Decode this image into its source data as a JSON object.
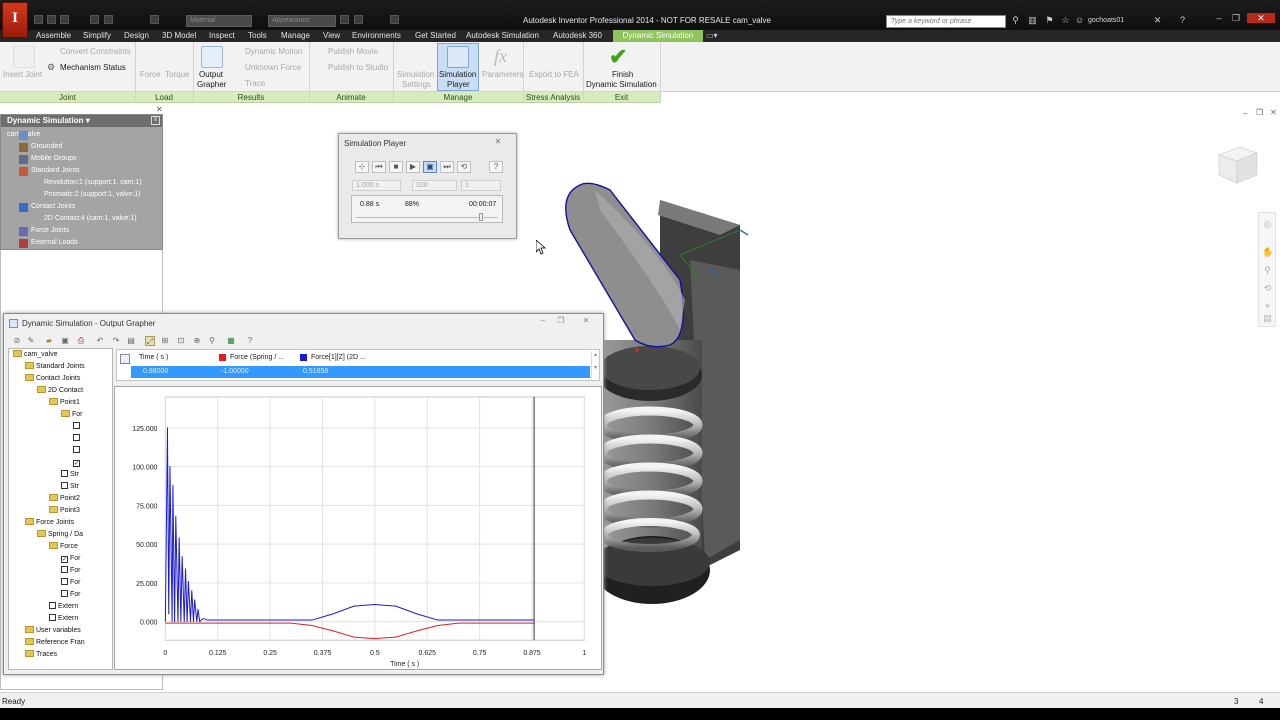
{
  "app": {
    "logo": "I",
    "title": "Autodesk Inventor Professional 2014 - NOT FOR RESALE   cam_valve",
    "material_placeholder": "Material",
    "appearance_placeholder": "Appearance",
    "search_placeholder": "Type a keyword or phrase",
    "user": "gochoats01"
  },
  "ribbon_tabs": [
    "Assemble",
    "Simplify",
    "Design",
    "3D Model",
    "Inspect",
    "Tools",
    "Manage",
    "View",
    "Environments",
    "Get Started",
    "Autodesk Simulation",
    "Autodesk 360",
    "Dynamic Simulation"
  ],
  "ribbon": {
    "joint": {
      "insert_joint": "Insert Joint",
      "convert_constraints": "Convert Constraints",
      "mechanism_status": "Mechanism Status"
    },
    "load": {
      "force": "Force",
      "torque": "Torque"
    },
    "results": {
      "output_grapher_1": "Output",
      "output_grapher_2": "Grapher",
      "dynamic_motion": "Dynamic Motion",
      "unknown_force": "Unknown Force",
      "trace": "Trace"
    },
    "animate": {
      "publish_movie": "Publish Movie",
      "publish_studio": "Publish to Studio"
    },
    "manage": {
      "sim_settings_1": "Simulation",
      "sim_settings_2": "Settings",
      "sim_player_1": "Simulation",
      "sim_player_2": "Player",
      "parameters": "Parameters"
    },
    "stress": {
      "export_fea": "Export to FEA"
    },
    "exit": {
      "finish_1": "Finish",
      "finish_2": "Dynamic Simulation"
    },
    "groups": [
      "Joint",
      "Load",
      "Results",
      "Animate",
      "Manage",
      "Stress Analysis",
      "Exit"
    ]
  },
  "browser": {
    "title": "Dynamic Simulation",
    "items": [
      {
        "label": "cam_valve",
        "level": 0
      },
      {
        "label": "Grounded",
        "level": 1
      },
      {
        "label": "Mobile Groups",
        "level": 1
      },
      {
        "label": "Standard Joints",
        "level": 1
      },
      {
        "label": "Revolution:1 (support:1, cam:1)",
        "level": 2
      },
      {
        "label": "Prismatic:2 (support:1, valve:1)",
        "level": 2
      },
      {
        "label": "Contact Joints",
        "level": 1
      },
      {
        "label": "2D Contact:4 (cam:1, valve:1)",
        "level": 2
      },
      {
        "label": "Force Joints",
        "level": 1
      },
      {
        "label": "External Loads",
        "level": 1
      }
    ]
  },
  "sim_player": {
    "title": "Simulation Player",
    "end_time": "1.000 s",
    "images": "100",
    "filter": "1",
    "current_time": "0.88 s",
    "percent": "88%",
    "elapsed": "00:00:07",
    "progress": 0.88
  },
  "grapher": {
    "title": "Dynamic Simulation - Output Grapher",
    "tree": [
      {
        "label": "cam_valve",
        "ind": 0,
        "t": "f"
      },
      {
        "label": "Standard Joints",
        "ind": 1,
        "t": "f"
      },
      {
        "label": "Contact Joints",
        "ind": 1,
        "t": "f"
      },
      {
        "label": "2D Contact",
        "ind": 2,
        "t": "f"
      },
      {
        "label": "Point1",
        "ind": 3,
        "t": "f"
      },
      {
        "label": "For",
        "ind": 4,
        "t": "f"
      },
      {
        "label": "",
        "ind": 5,
        "t": "c"
      },
      {
        "label": "",
        "ind": 5,
        "t": "c"
      },
      {
        "label": "",
        "ind": 5,
        "t": "c"
      },
      {
        "label": "",
        "ind": 5,
        "t": "k"
      },
      {
        "label": "Str",
        "ind": 4,
        "t": "c"
      },
      {
        "label": "Str",
        "ind": 4,
        "t": "c"
      },
      {
        "label": "Point2",
        "ind": 3,
        "t": "f"
      },
      {
        "label": "Point3",
        "ind": 3,
        "t": "f"
      },
      {
        "label": "Force Joints",
        "ind": 1,
        "t": "f"
      },
      {
        "label": "Spring / Da",
        "ind": 2,
        "t": "f"
      },
      {
        "label": "Force",
        "ind": 3,
        "t": "f"
      },
      {
        "label": "For",
        "ind": 4,
        "t": "k"
      },
      {
        "label": "For",
        "ind": 4,
        "t": "c"
      },
      {
        "label": "For",
        "ind": 4,
        "t": "c"
      },
      {
        "label": "For",
        "ind": 4,
        "t": "c"
      },
      {
        "label": "Extern",
        "ind": 3,
        "t": "c"
      },
      {
        "label": "Extern",
        "ind": 3,
        "t": "c"
      },
      {
        "label": "User variables",
        "ind": 1,
        "t": "f"
      },
      {
        "label": "Reference Fran",
        "ind": 1,
        "t": "f"
      },
      {
        "label": "Traces",
        "ind": 1,
        "t": "f"
      }
    ],
    "columns": [
      "Time ( s )",
      "Force (Spring / ...",
      "Force[1][Z] (2D ..."
    ],
    "row": [
      "0.88000",
      "-1.00000",
      "0.51858"
    ]
  },
  "chart_data": {
    "type": "line",
    "xlabel": "Time ( s )",
    "ylabel": "",
    "xlim": [
      0,
      1
    ],
    "ylim": [
      -12,
      145
    ],
    "x_ticks": [
      "0",
      "0.125",
      "0.25",
      "0.375",
      "0.5",
      "0.625",
      "0.75",
      "0.875",
      "1"
    ],
    "y_ticks": [
      "0.000",
      "25.000",
      "50.000",
      "75.000",
      "100.000",
      "125.000"
    ],
    "cursor_x": 0.88,
    "colors": {
      "red": "#e02020",
      "blue": "#1a1ad0"
    },
    "series": [
      {
        "name": "Force (Spring / ...",
        "color": "#e02020",
        "x": [
          0,
          0.3,
          0.35,
          0.4,
          0.45,
          0.5,
          0.55,
          0.6,
          0.65,
          0.7,
          0.88
        ],
        "y": [
          -1,
          -1,
          -2.5,
          -6,
          -10,
          -11,
          -10,
          -6,
          -2.5,
          -1,
          -1
        ]
      },
      {
        "name": "Force[1][Z] (2D ...",
        "color": "#1a1ad0",
        "x": [
          0,
          0.005,
          0.008,
          0.011,
          0.016,
          0.018,
          0.022,
          0.025,
          0.03,
          0.033,
          0.037,
          0.04,
          0.045,
          0.048,
          0.052,
          0.055,
          0.06,
          0.063,
          0.067,
          0.07,
          0.075,
          0.078,
          0.082,
          0.09,
          0.1,
          0.35,
          0.4,
          0.45,
          0.5,
          0.55,
          0.6,
          0.65,
          0.88
        ],
        "y": [
          0,
          125,
          5,
          100,
          0,
          88,
          0,
          68,
          0,
          54,
          0,
          42,
          0,
          34,
          0,
          26,
          0,
          20,
          0,
          14,
          0,
          8,
          0,
          2,
          1,
          1,
          5,
          10,
          11,
          10,
          5,
          1,
          1
        ]
      }
    ]
  },
  "status": {
    "text": "Ready",
    "n1": "3",
    "n2": "4"
  }
}
